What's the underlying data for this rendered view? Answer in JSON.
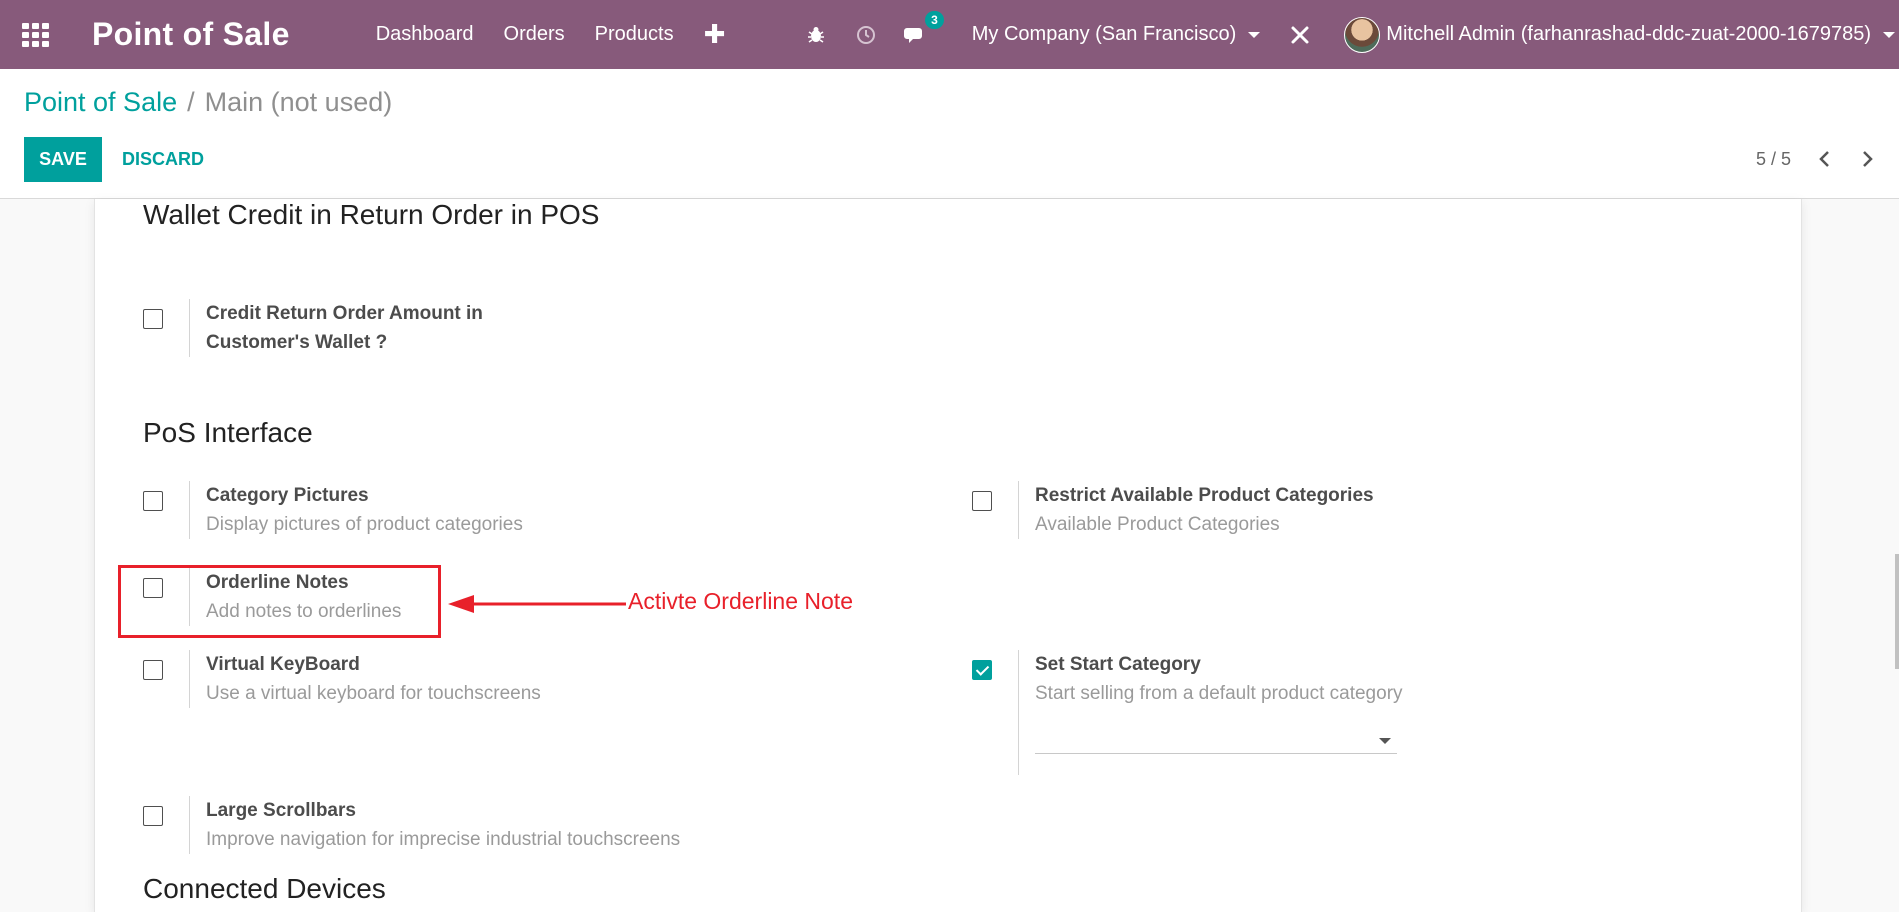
{
  "navbar": {
    "brand": "Point of Sale",
    "menu": [
      "Dashboard",
      "Orders",
      "Products"
    ],
    "messages_count": "3",
    "company": "My Company (San Francisco)",
    "user": "Mitchell Admin (farhanrashad-ddc-zuat-2000-1679785)",
    "bg_color": "#875a7b"
  },
  "control_panel": {
    "breadcrumb_parent": "Point of Sale",
    "breadcrumb_separator": "/",
    "breadcrumb_current": "Main (not used)",
    "save_label": "SAVE",
    "discard_label": "DISCARD",
    "pager": "5 / 5",
    "accent_color": "#00a09d"
  },
  "sections": {
    "wallet_title": "Wallet Credit in Return Order in POS",
    "interface_title": "PoS Interface",
    "devices_title": "Connected Devices"
  },
  "settings": {
    "credit_return": {
      "label_line1": "Credit Return Order Amount in",
      "label_line2": "Customer's Wallet ?",
      "checked": false
    },
    "category_pictures": {
      "label": "Category Pictures",
      "help": "Display pictures of product categories",
      "checked": false
    },
    "restrict_categories": {
      "label": "Restrict Available Product Categories",
      "help": "Available Product Categories",
      "checked": false
    },
    "orderline_notes": {
      "label": "Orderline Notes",
      "help": "Add notes to orderlines",
      "checked": false
    },
    "virtual_keyboard": {
      "label": "Virtual KeyBoard",
      "help": "Use a virtual keyboard for touchscreens",
      "checked": false
    },
    "start_category": {
      "label": "Set Start Category",
      "help": "Start selling from a default product category",
      "checked": true,
      "selected_value": ""
    },
    "large_scrollbars": {
      "label": "Large Scrollbars",
      "help": "Improve navigation for imprecise industrial touchscreens",
      "checked": false
    }
  },
  "annotation": {
    "text": "Activte Orderline Note",
    "color": "#e8202a"
  }
}
